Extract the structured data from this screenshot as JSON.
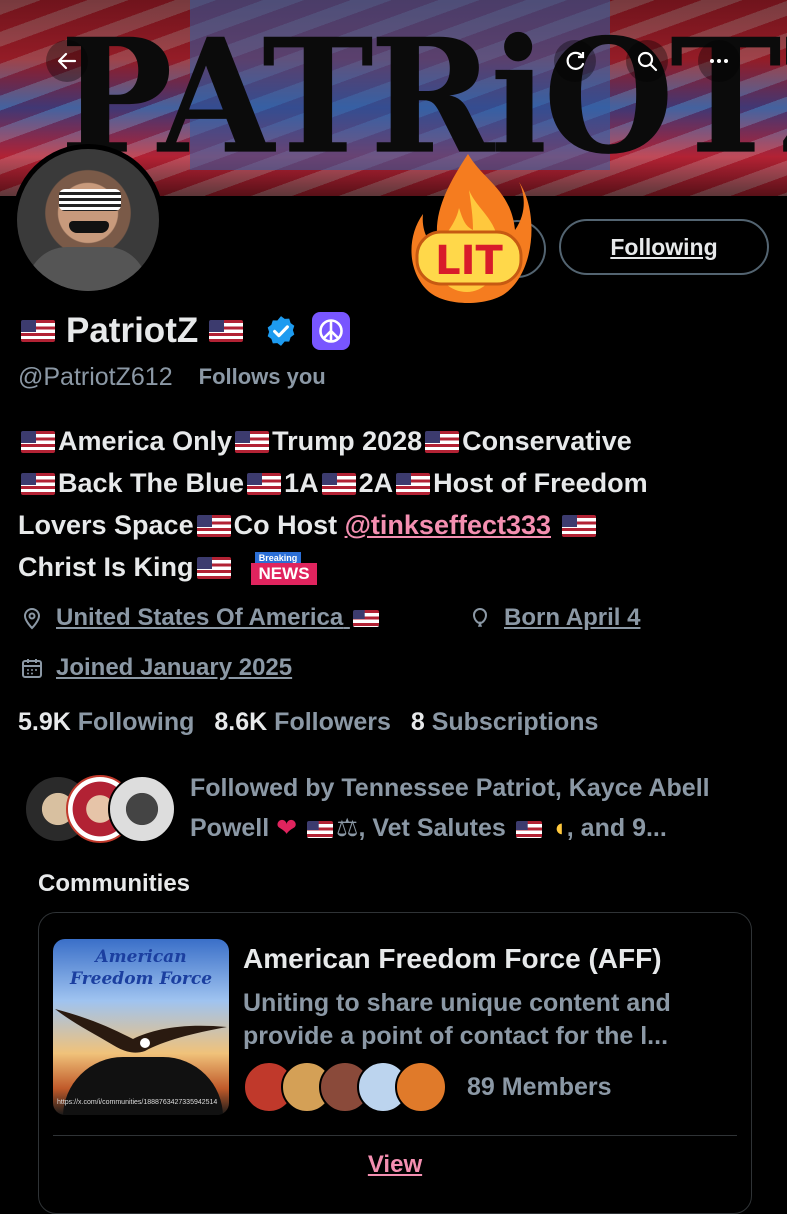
{
  "banner": {
    "logo_text": "PATRiOTZ",
    "colors": {
      "red": "#b22234",
      "blue": "#2b5fa8"
    }
  },
  "nav": {
    "back_icon": "arrow-left-icon",
    "refresh_icon": "refresh-icon",
    "search_icon": "search-icon",
    "more_icon": "more-horizontal-icon"
  },
  "lit_sticker": {
    "text": "LIT"
  },
  "following_button": {
    "label": "Following"
  },
  "profile": {
    "name": "PatriotZ",
    "handle": "@PatriotZ612",
    "follows_you": "Follows you"
  },
  "bio": {
    "line1_a": "America Only",
    "line1_b": "Trump 2028",
    "line1_c": "Conservative",
    "line2_a": "Back The Blue",
    "line2_b": "1A",
    "line2_c": "2A",
    "line2_d": "Host of Freedom",
    "line3_a": "Lovers Space",
    "line3_b": "Co Host ",
    "mention": "@tinkseffect333",
    "line4_a": "Christ Is King",
    "breaking_top": "Breaking",
    "breaking_bottom": "NEWS"
  },
  "meta": {
    "location": "United States Of America",
    "birthday": "Born April 4",
    "joined": "Joined January 2025"
  },
  "stats": {
    "following_count": "5.9K",
    "following_label": "Following",
    "followers_count": "8.6K",
    "followers_label": "Followers",
    "subscriptions_count": "8",
    "subscriptions_label": "Subscriptions"
  },
  "followed_by": {
    "part1": "Followed by Tennessee Patriot, Kayce Abell",
    "part2": "Powell",
    "part3": ", Vet Salutes",
    "part4": ", and 9..."
  },
  "communities": {
    "title": "Communities",
    "card": {
      "image_title_1": "American",
      "image_title_2": "Freedom Force",
      "image_url": "https://x.com/i/communities/1888763427335942514",
      "name": "American Freedom Force (AFF)",
      "description": "Uniting to share unique content and provide a point of contact for the l...",
      "members": "89 Members",
      "view_label": "View"
    }
  }
}
